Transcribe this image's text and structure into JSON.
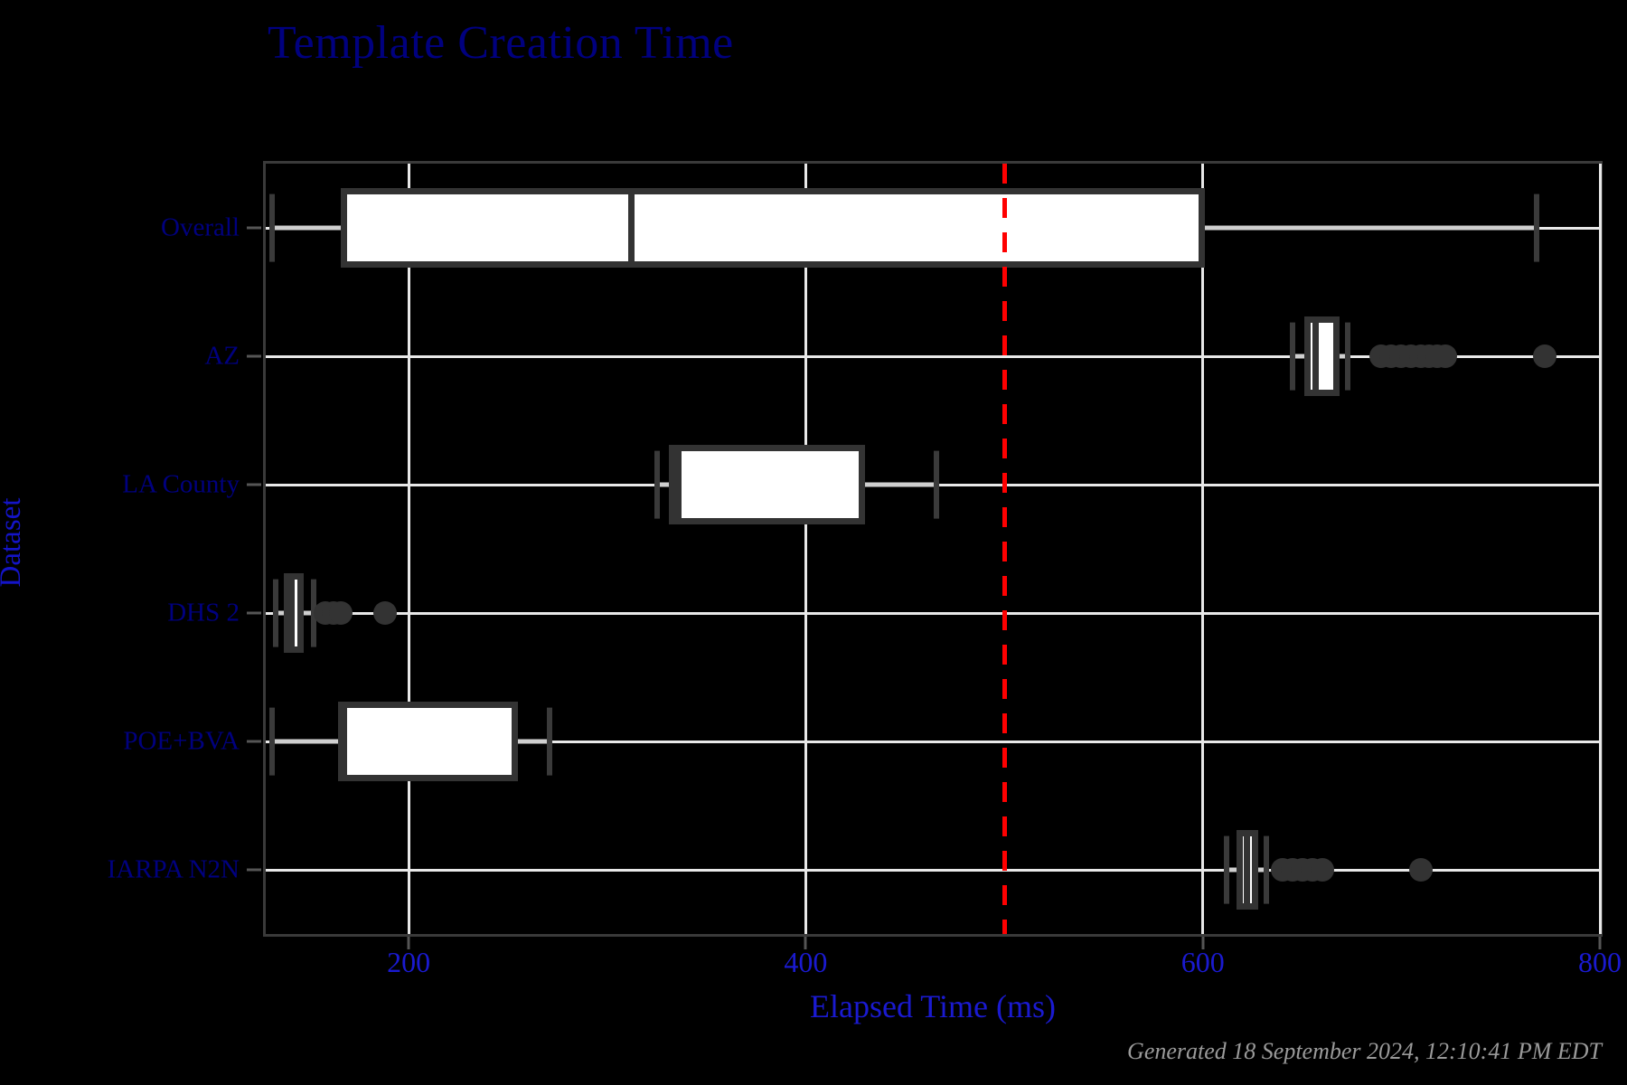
{
  "chart_data": {
    "type": "box",
    "title": "Template Creation Time",
    "xlabel": "Elapsed Time (ms)",
    "ylabel": "Dataset",
    "xlim": [
      128,
      800
    ],
    "xticks": [
      200,
      400,
      600,
      800
    ],
    "xtick_labels": [
      "200",
      "400",
      "600",
      "800"
    ],
    "categories": [
      "Overall",
      "AZ",
      "LA County",
      "DHS 2",
      "POE+BVA",
      "IARPA N2N"
    ],
    "grid": "both",
    "legend": "none",
    "reference_line": {
      "value": 500,
      "orientation": "vertical",
      "style": "dashed",
      "color": "#ff0000"
    },
    "boxes": [
      {
        "category": "Overall",
        "whisker_low": 131,
        "q1": 166,
        "median": 312,
        "q3": 601,
        "whisker_high": 768,
        "outliers": []
      },
      {
        "category": "AZ",
        "whisker_low": 645,
        "q1": 651,
        "median": 657,
        "q3": 669,
        "whisker_high": 673,
        "outliers": [
          690,
          695,
          700,
          705,
          710,
          714,
          718,
          722,
          772
        ]
      },
      {
        "category": "LA County",
        "whisker_low": 325,
        "q1": 331,
        "median": 336,
        "q3": 430,
        "whisker_high": 466,
        "outliers": []
      },
      {
        "category": "DHS 2",
        "whisker_low": 133,
        "q1": 137,
        "median": 141,
        "q3": 147,
        "whisker_high": 152,
        "outliers": [
          158,
          162,
          166,
          188
        ]
      },
      {
        "category": "POE+BVA",
        "whisker_low": 131,
        "q1": 166,
        "median": 166,
        "q3": 255,
        "whisker_high": 271,
        "outliers": []
      },
      {
        "category": "IARPA N2N",
        "whisker_low": 612,
        "q1": 617,
        "median": 622,
        "q3": 628,
        "whisker_high": 632,
        "outliers": [
          640,
          645,
          650,
          655,
          660,
          710
        ]
      }
    ],
    "colors": {
      "background": "#000000",
      "title": "#00007f",
      "axis_text": "#1a1ad0",
      "box_face": "#ffffff",
      "box_edge": "#333333",
      "whisker": "#cfcfcf",
      "grid": "#e8e8e8",
      "reference": "#ff0000",
      "footer": "#9a9a9a"
    }
  },
  "footer": {
    "generated": "Generated 18 September 2024, 12:10:41 PM EDT"
  }
}
